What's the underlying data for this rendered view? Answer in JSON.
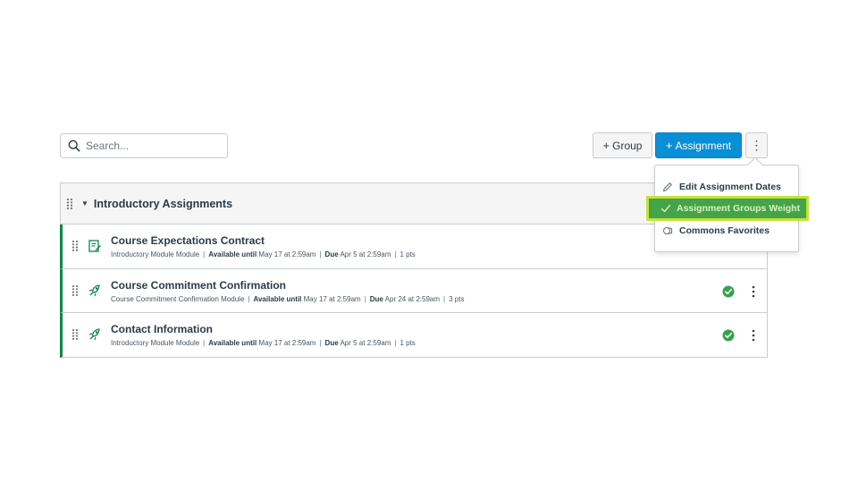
{
  "toolbar": {
    "search_placeholder": "Search...",
    "group_button": "Group",
    "assignment_button": "Assignment",
    "more_label": "⋮"
  },
  "group": {
    "title": "Introductory Assignments"
  },
  "assignments": [
    {
      "title": "Course Expectations Contract",
      "module": "Introductory Module Module",
      "available_label": "Available until",
      "available_value": "May 17 at 2:59am",
      "due_label": "Due",
      "due_value": "Apr 5 at 2:59am",
      "points": "1 pts",
      "type_icon": "assignment-icon",
      "has_status": false
    },
    {
      "title": "Course Commitment Confirmation",
      "module": "Course Commitment Confirmation Module",
      "available_label": "Available until",
      "available_value": "May 17 at 2:59am",
      "due_label": "Due",
      "due_value": "Apr 24 at 2:59am",
      "points": "3 pts",
      "type_icon": "quiz-icon",
      "has_status": true
    },
    {
      "title": "Contact Information",
      "module": "Introductory Module Module",
      "available_label": "Available until",
      "available_value": "May 17 at 2:59am",
      "due_label": "Due",
      "due_value": "Apr 5 at 2:59am",
      "points": "1 pts",
      "type_icon": "quiz-icon",
      "has_status": true
    }
  ],
  "menu": {
    "items": [
      {
        "label": "Edit Assignment Dates",
        "icon": "pencil-icon"
      },
      {
        "label": "Assignment Groups Weight",
        "icon": "check-icon",
        "highlighted": true
      },
      {
        "label": "Commons Favorites",
        "icon": "commons-icon"
      }
    ]
  },
  "colors": {
    "primary": "#0a8ed6",
    "published_border": "#0b874b",
    "status_green": "#35a24b",
    "highlight_fill": "#45a34a",
    "highlight_border": "#c4e23a"
  }
}
